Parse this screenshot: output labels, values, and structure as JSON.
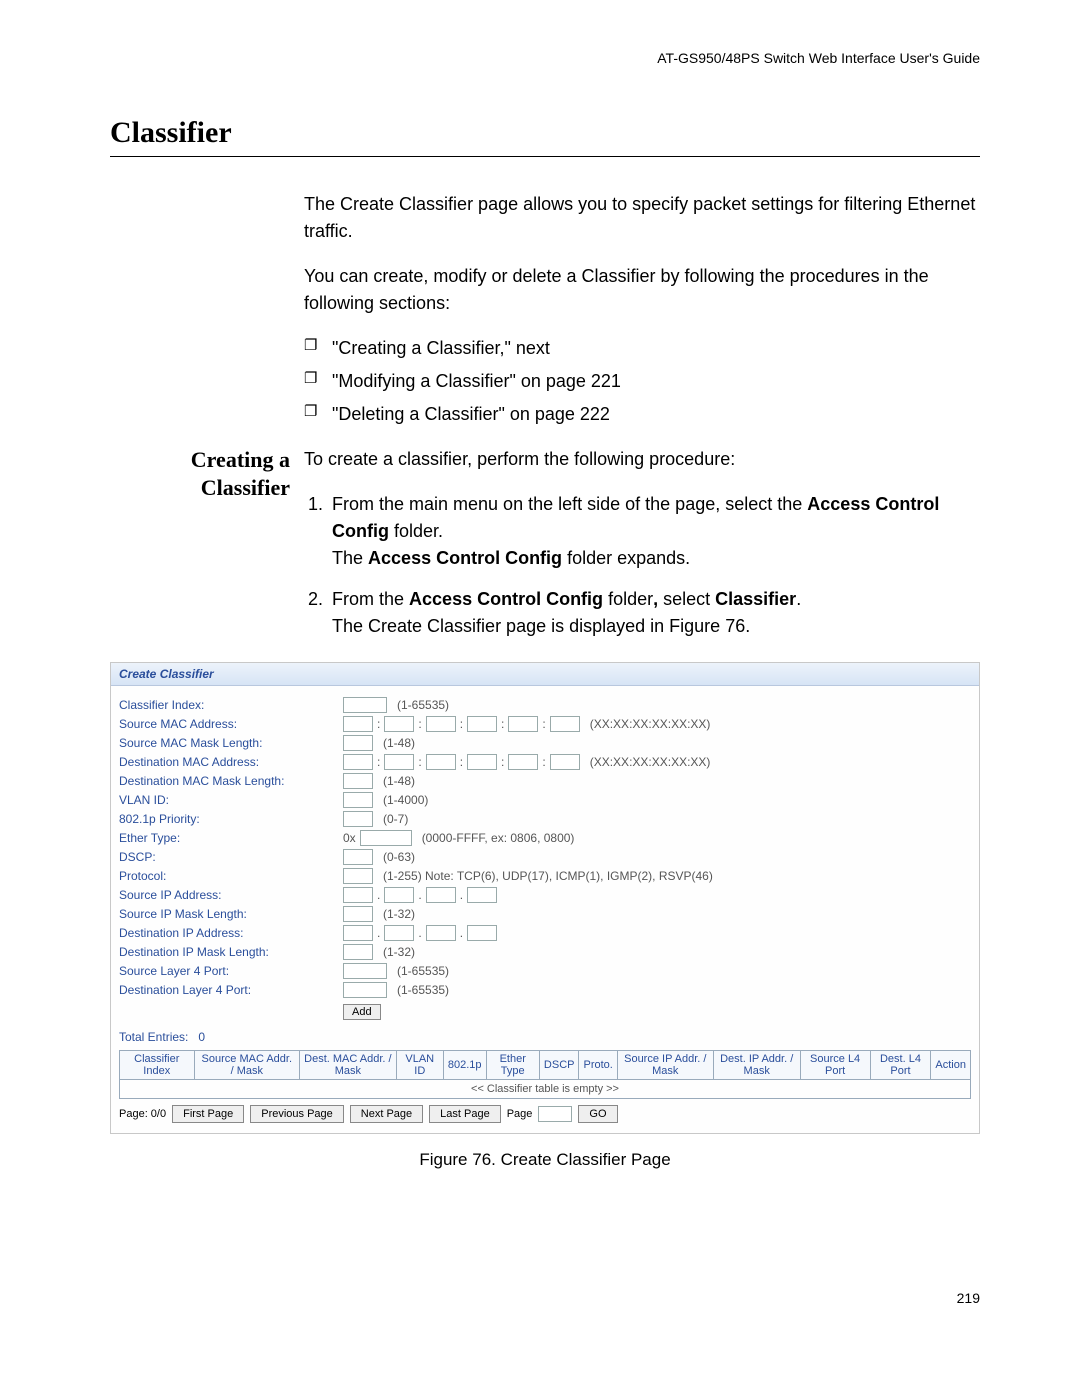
{
  "header": {
    "running": "AT-GS950/48PS Switch Web Interface User's Guide"
  },
  "title": "Classifier",
  "intro": {
    "p1": "The Create Classifier page allows you to specify packet settings for filtering Ethernet traffic.",
    "p2": "You can create, modify or delete a Classifier by following the procedures in the following sections:"
  },
  "bullets": [
    "\"Creating a Classifier,\"  next",
    "\"Modifying a Classifier\" on page 221",
    "\"Deleting a Classifier\" on page 222"
  ],
  "aside": "Creating a Classifier",
  "lead": "To create a classifier, perform the following procedure:",
  "steps": {
    "s1a": "From the main menu on the left side of the page, select the ",
    "s1b": "Access Control Config",
    "s1c": " folder.",
    "s1d": "The ",
    "s1e": "Access Control Config",
    "s1f": " folder expands.",
    "s2a": "From the ",
    "s2b": "Access Control Config",
    "s2c": " folder",
    "s2d": ",",
    "s2e": " select ",
    "s2f": "Classifier",
    "s2g": ".",
    "s2h": "The Create Classifier page is displayed in Figure 76."
  },
  "form": {
    "title": "Create Classifier",
    "rows": [
      {
        "label": "Classifier Index:",
        "type": "single",
        "width": "md",
        "hint": "(1-65535)"
      },
      {
        "label": "Source MAC Address:",
        "type": "mac6",
        "hint": "(XX:XX:XX:XX:XX:XX)"
      },
      {
        "label": "Source MAC Mask Length:",
        "type": "single",
        "width": "sm",
        "hint": "(1-48)"
      },
      {
        "label": "Destination MAC Address:",
        "type": "mac6",
        "hint": "(XX:XX:XX:XX:XX:XX)"
      },
      {
        "label": "Destination MAC Mask Length:",
        "type": "single",
        "width": "sm",
        "hint": "(1-48)"
      },
      {
        "label": "VLAN ID:",
        "type": "single",
        "width": "sm",
        "hint": "(1-4000)"
      },
      {
        "label": "802.1p Priority:",
        "type": "single",
        "width": "sm",
        "hint": "(0-7)"
      },
      {
        "label": "Ether Type:",
        "type": "ether",
        "prefix": "0x",
        "width": "lg",
        "hint": "(0000-FFFF, ex: 0806, 0800)"
      },
      {
        "label": "DSCP:",
        "type": "single",
        "width": "sm",
        "hint": "(0-63)"
      },
      {
        "label": "Protocol:",
        "type": "single",
        "width": "sm",
        "hint": "(1-255) Note: TCP(6), UDP(17), ICMP(1), IGMP(2), RSVP(46)"
      },
      {
        "label": "Source IP Address:",
        "type": "ip4"
      },
      {
        "label": "Source IP Mask Length:",
        "type": "single",
        "width": "sm",
        "hint": "(1-32)"
      },
      {
        "label": "Destination IP Address:",
        "type": "ip4"
      },
      {
        "label": "Destination IP Mask Length:",
        "type": "single",
        "width": "sm",
        "hint": "(1-32)"
      },
      {
        "label": "Source Layer 4 Port:",
        "type": "single",
        "width": "md",
        "hint": "(1-65535)"
      },
      {
        "label": "Destination Layer 4 Port:",
        "type": "single",
        "width": "md",
        "hint": "(1-65535)"
      }
    ],
    "add": "Add",
    "total_label": "Total Entries:",
    "total_value": "0",
    "columns": [
      "Classifier Index",
      "Source MAC Addr. / Mask",
      "Dest. MAC Addr. / Mask",
      "VLAN ID",
      "802.1p",
      "Ether Type",
      "DSCP",
      "Proto.",
      "Source IP Addr. / Mask",
      "Dest. IP Addr. / Mask",
      "Source L4 Port",
      "Dest. L4 Port",
      "Action"
    ],
    "empty_msg": "<< Classifier table is empty >>",
    "pager": {
      "indicator": "Page: 0/0",
      "first": "First Page",
      "prev": "Previous Page",
      "next": "Next Page",
      "last": "Last Page",
      "page_label": "Page",
      "go": "GO"
    }
  },
  "figcap": "Figure 76. Create Classifier Page",
  "pagenum": "219"
}
